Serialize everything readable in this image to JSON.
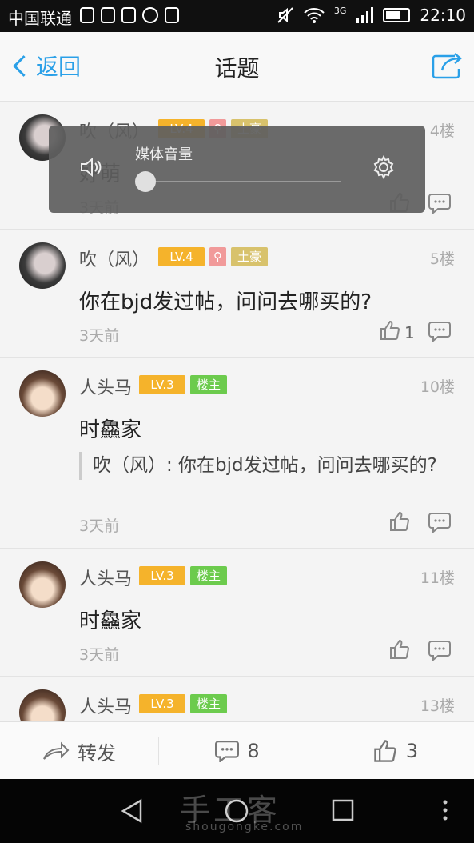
{
  "status_bar": {
    "carrier": "中国联通",
    "network": "3G",
    "time": "22:10"
  },
  "header": {
    "back_label": "返回",
    "title": "话题"
  },
  "posts": [
    {
      "username": "吹（风）",
      "level": "LV.4",
      "rich_badge": "土豪",
      "floor": "4楼",
      "content": "好萌",
      "time": "3天前"
    },
    {
      "username": "吹（风）",
      "level": "LV.4",
      "rich_badge": "土豪",
      "floor": "5楼",
      "content": "你在bjd发过帖，问问去哪买的?",
      "time": "3天前",
      "like_count": "1"
    },
    {
      "username": "人头马",
      "level": "LV.3",
      "owner_badge": "楼主",
      "floor": "10楼",
      "content": "时鱻家",
      "quote": "吹（风）: 你在bjd发过帖，问问去哪买的?",
      "time": "3天前"
    },
    {
      "username": "人头马",
      "level": "LV.3",
      "owner_badge": "楼主",
      "floor": "11楼",
      "content": "时鱻家",
      "time": "3天前"
    },
    {
      "username": "人头马",
      "level": "LV.3",
      "owner_badge": "楼主",
      "floor": "13楼"
    }
  ],
  "volume_overlay": {
    "title": "媒体音量",
    "level": 0.0
  },
  "action_bar": {
    "forward_label": "转发",
    "comment_count": "8",
    "like_count": "3"
  },
  "watermark": {
    "text": "手工客",
    "url": "shougongke.com"
  },
  "colors": {
    "accent": "#2aa0e8",
    "level_badge": "#f5b32b",
    "owner_badge": "#6ccb4d",
    "rich_badge": "#d8c26c"
  },
  "icons": [
    "back-chevron-icon",
    "share-icon",
    "like-icon",
    "comment-icon",
    "speaker-icon",
    "settings-gear-icon",
    "forward-icon",
    "nav-back-icon",
    "nav-home-icon",
    "nav-recents-icon",
    "nav-menu-icon"
  ]
}
